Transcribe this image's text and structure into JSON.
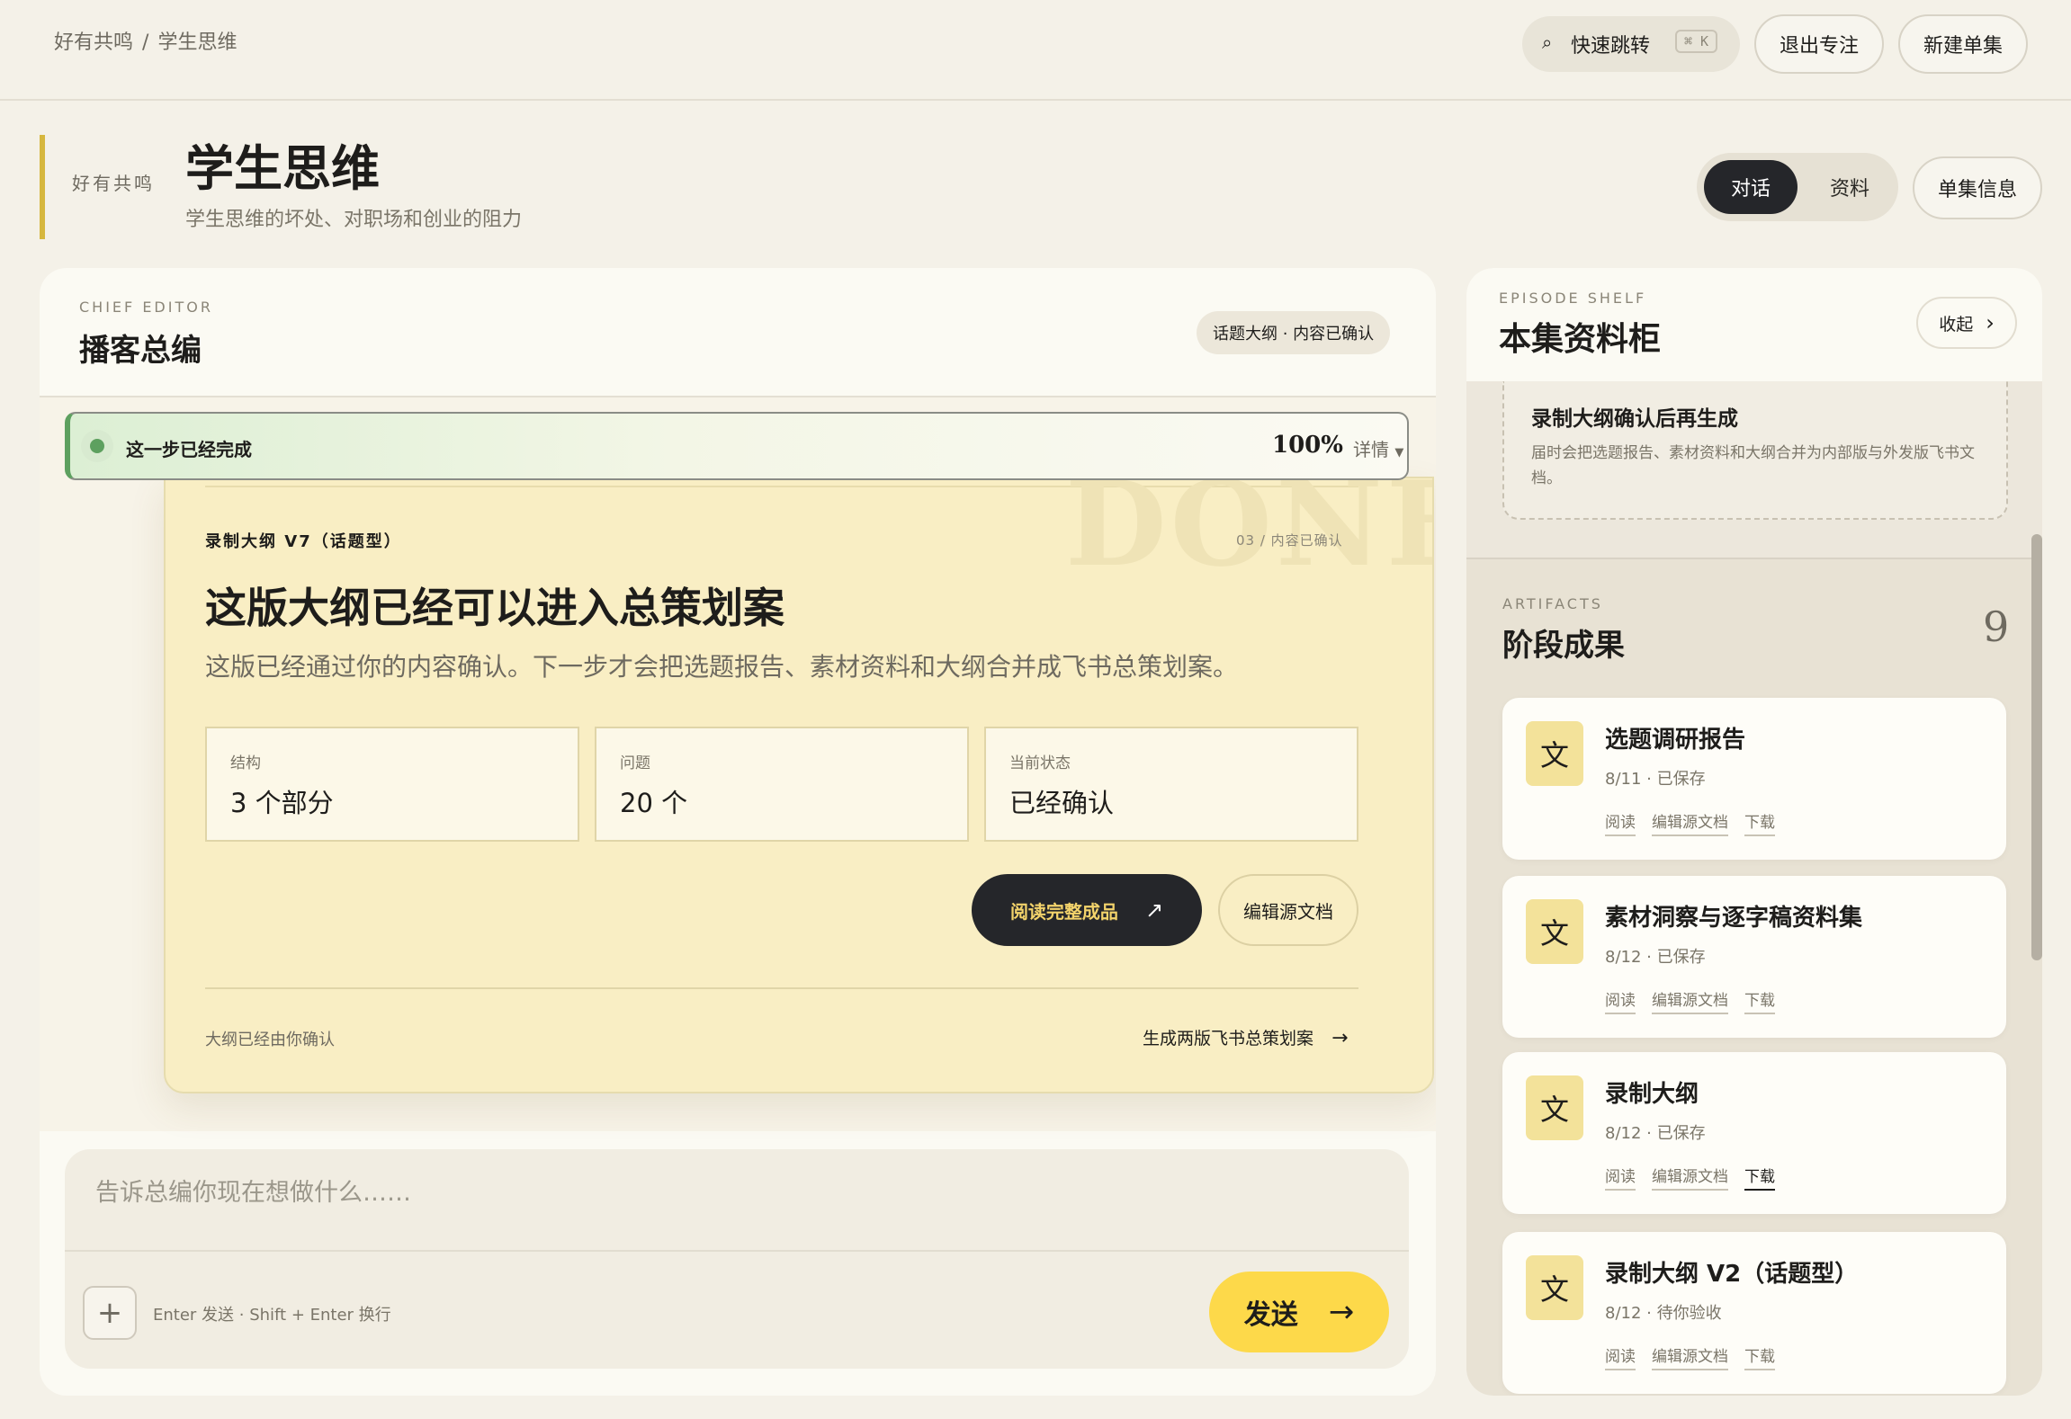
{
  "breadcrumb": {
    "parent": "好有共鸣",
    "sep": "/",
    "current": "学生思维"
  },
  "topbar": {
    "search_icon": "⌕",
    "quick_jump": "快速跳转",
    "shortcut": "⌘ K",
    "exit_focus": "退出专注",
    "new_episode": "新建单集"
  },
  "header": {
    "show": "好有共鸣",
    "title": "学生思维",
    "subtitle": "学生思维的坏处、对职场和创业的阻力"
  },
  "view_tabs": {
    "chat": "对话",
    "materials": "资料",
    "active": "对话"
  },
  "episode_info": "单集信息",
  "editor": {
    "caption": "CHIEF EDITOR",
    "title": "播客总编",
    "badge": "话题大纲 · 内容已确认"
  },
  "progress": {
    "text": "这一步已经完成",
    "percent": "100%",
    "details": "详情",
    "value": 1.0
  },
  "outline_card": {
    "watermark": "DONE",
    "label": "录制大纲 V7（话题型）",
    "meta": "03 / 内容已确认",
    "headline": "这版大纲已经可以进入总策划案",
    "description": "这版已经通过你的内容确认。下一步才会把选题报告、素材资料和大纲合并成飞书总策划案。",
    "stats": [
      {
        "label": "结构",
        "value": "3 个部分"
      },
      {
        "label": "问题",
        "value": "20 个"
      },
      {
        "label": "当前状态",
        "value": "已经确认"
      }
    ],
    "primary_button": "阅读完整成品",
    "primary_icon": "↗",
    "secondary_button": "编辑源文档",
    "footer_note": "大纲已经由你确认",
    "footer_action": "生成两版飞书总策划案",
    "footer_arrow": "→"
  },
  "composer": {
    "placeholder": "告诉总编你现在想做什么……",
    "add": "+",
    "hint": "Enter 发送 · Shift + Enter 换行",
    "send": "发送",
    "send_arrow": "→"
  },
  "shelf": {
    "caption": "EPISODE SHELF",
    "title": "本集资料柜",
    "collapse": "收起",
    "collapse_icon": "›",
    "pending_title": "录制大纲确认后再生成",
    "pending_desc": "届时会把选题报告、素材资料和大纲合并为内部版与外发版飞书文档。"
  },
  "artifacts": {
    "caption": "ARTIFACTS",
    "title": "阶段成果",
    "count": "9",
    "items": [
      {
        "icon": "文",
        "title": "选题调研报告",
        "meta": "8/11 · 已保存",
        "read": "阅读",
        "edit": "编辑源文档",
        "download": "下载"
      },
      {
        "icon": "文",
        "title": "素材洞察与逐字稿资料集",
        "meta": "8/12 · 已保存",
        "read": "阅读",
        "edit": "编辑源文档",
        "download": "下载"
      },
      {
        "icon": "文",
        "title": "录制大纲",
        "meta": "8/12 · 已保存",
        "read": "阅读",
        "edit": "编辑源文档",
        "download": "下载"
      },
      {
        "icon": "文",
        "title": "录制大纲 V2（话题型）",
        "meta": "8/12 · 待你验收",
        "read": "阅读",
        "edit": "编辑源文档",
        "download": "下载"
      }
    ]
  },
  "colors": {
    "accent_yellow": "#fdd94a",
    "success_green": "#5da05f",
    "dark": "#25262a",
    "card_bg": "#f9eec4"
  }
}
